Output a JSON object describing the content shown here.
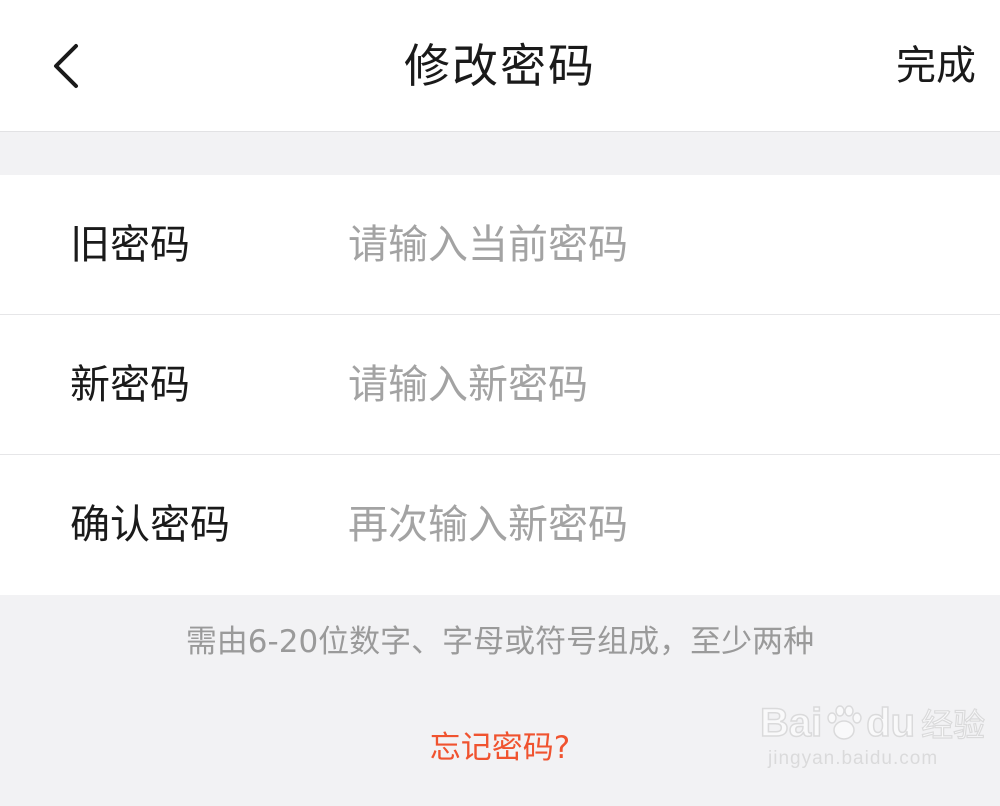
{
  "header": {
    "title": "修改密码",
    "done_label": "完成"
  },
  "form": {
    "rows": [
      {
        "label": "旧密码",
        "placeholder": "请输入当前密码",
        "value": ""
      },
      {
        "label": "新密码",
        "placeholder": "请输入新密码",
        "value": ""
      },
      {
        "label": "确认密码",
        "placeholder": "再次输入新密码",
        "value": ""
      }
    ]
  },
  "hint": "需由6-20位数字、字母或符号组成，至少两种",
  "forgot_label": "忘记密码?",
  "watermark": {
    "brand_left": "Bai",
    "brand_right": "du",
    "brand_cn": "经验",
    "url": "jingyan.baidu.com"
  },
  "colors": {
    "accent": "#f0532f",
    "page_bg": "#f2f2f4",
    "placeholder": "#a3a3a3",
    "text": "#1a1a1a"
  },
  "icons": {
    "back": "chevron-left-icon"
  }
}
